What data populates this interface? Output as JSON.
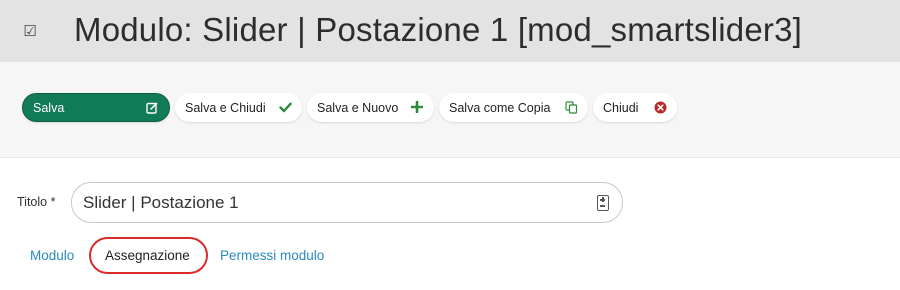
{
  "header": {
    "icon": "checkbox-icon",
    "title": "Modulo: Slider | Postazione 1 [mod_smartslider3]"
  },
  "toolbar": {
    "save_label": "Salva",
    "save_close_label": "Salva e Chiudi",
    "save_new_label": "Salva e Nuovo",
    "save_copy_label": "Salva come Copia",
    "close_label": "Chiudi"
  },
  "colors": {
    "primary": "#117a56",
    "check": "#2e8b3c",
    "close": "#b72b2b",
    "link": "#2a8ac4",
    "highlight": "#d92a2a"
  },
  "form": {
    "title_label": "Titolo *",
    "title_value": "Slider | Postazione 1"
  },
  "tabs": [
    {
      "label": "Modulo"
    },
    {
      "label": "Assegnazione",
      "active": true
    },
    {
      "label": "Permessi modulo"
    }
  ]
}
